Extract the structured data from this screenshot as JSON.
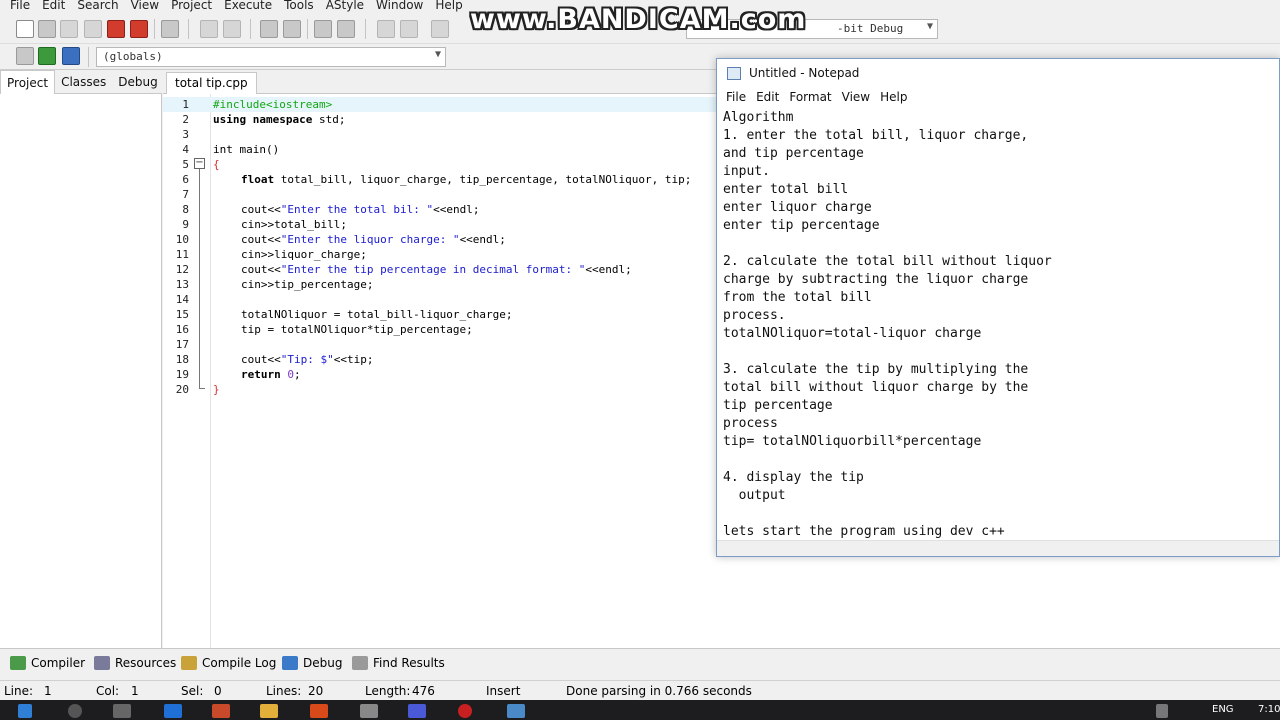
{
  "ide": {
    "menu": [
      "File",
      "Edit",
      "Search",
      "View",
      "Project",
      "Execute",
      "Tools",
      "AStyle",
      "Window",
      "Help"
    ],
    "globals_combo": "(globals)",
    "compiler_combo": "-bit Debug",
    "left_tabs": [
      "Project",
      "Classes",
      "Debug"
    ],
    "file_tab": "total tip.cpp",
    "bottom_tabs": [
      "Compiler",
      "Resources",
      "Compile Log",
      "Debug",
      "Find Results"
    ],
    "status": {
      "line_label": "Line:",
      "line_value": "1",
      "col_label": "Col:",
      "col_value": "1",
      "sel_label": "Sel:",
      "sel_value": "0",
      "lines_label": "Lines:",
      "lines_value": "20",
      "length_label": "Length:",
      "length_value": "476",
      "mode": "Insert",
      "message": "Done parsing in 0.766 seconds"
    }
  },
  "watermark": "www.BANDICAM.com",
  "code": {
    "line_numbers": [
      "1",
      "2",
      "3",
      "4",
      "5",
      "6",
      "7",
      "8",
      "9",
      "10",
      "11",
      "12",
      "13",
      "14",
      "15",
      "16",
      "17",
      "18",
      "19",
      "20"
    ],
    "lines": {
      "l1": "#include<iostream>",
      "l2_kw": "using namespace",
      "l2_rest": " std;",
      "l4": "int main()",
      "l5": "{",
      "l6_kw": "float",
      "l6_rest": " total_bill, liquor_charge, tip_percentage, totalNOliquor, tip;",
      "l8_a": "cout<<",
      "l8_s": "\"Enter the total bil: \"",
      "l8_b": "<<endl;",
      "l9": "cin>>total_bill;",
      "l10_a": "cout<<",
      "l10_s": "\"Enter the liquor charge: \"",
      "l10_b": "<<endl;",
      "l11": "cin>>liquor_charge;",
      "l12_a": "cout<<",
      "l12_s": "\"Enter the tip percentage in decimal format: \"",
      "l12_b": "<<endl;",
      "l13": "cin>>tip_percentage;",
      "l15": "totalNOliquor = total_bill-liquor_charge;",
      "l16": "tip = totalNOliquor*tip_percentage;",
      "l18_a": "cout<<",
      "l18_s": "\"Tip: $\"",
      "l18_b": "<<tip;",
      "l19_a": "return ",
      "l19_n": "0",
      "l19_b": ";",
      "l20": "}"
    }
  },
  "notepad": {
    "title": "Untitled - Notepad",
    "menu": [
      "File",
      "Edit",
      "Format",
      "View",
      "Help"
    ],
    "text": "Algorithm\n1. enter the total bill, liquor charge,\nand tip percentage\ninput.\nenter total bill\nenter liquor charge\nenter tip percentage\n\n2. calculate the total bill without liquor\ncharge by subtracting the liquor charge\nfrom the total bill\nprocess.\ntotalNOliquor=total-liquor charge\n\n3. calculate the tip by multiplying the\ntotal bill without liquor charge by the\ntip percentage\nprocess\ntip= totalNOliquorbill*percentage\n\n4. display the tip\n  output\n\nlets start the program using dev c++"
  },
  "taskbar": {
    "lang": "ENG",
    "time": "7:10"
  }
}
